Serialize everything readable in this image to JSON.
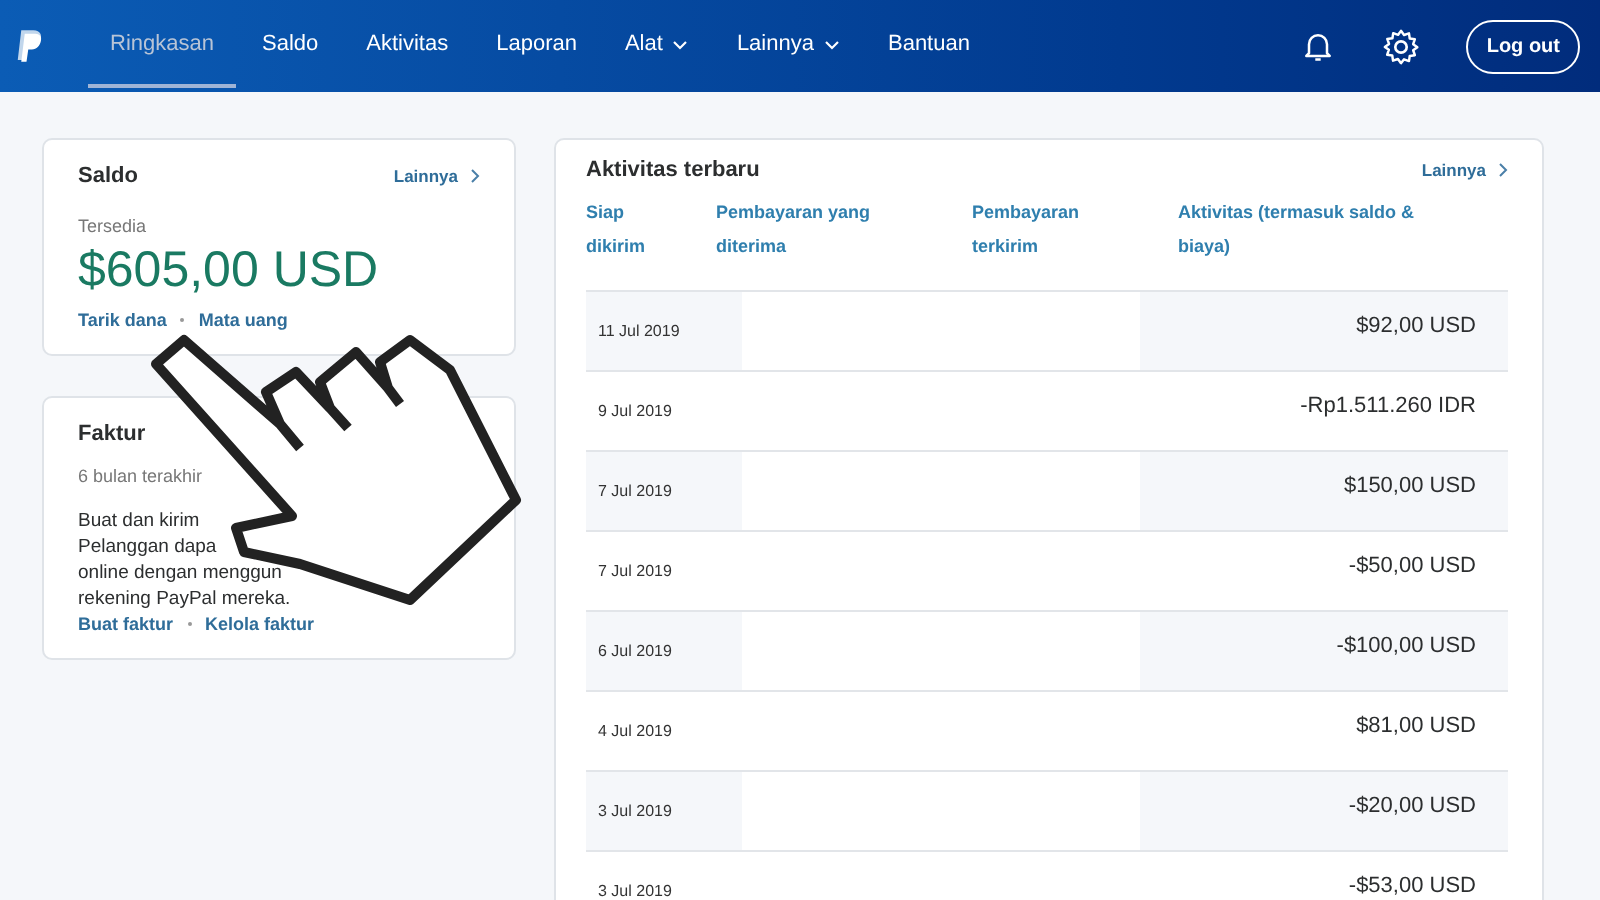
{
  "nav": {
    "items": [
      {
        "label": "Ringkasan",
        "selected": true,
        "has_menu": false
      },
      {
        "label": "Saldo",
        "selected": false,
        "has_menu": false
      },
      {
        "label": "Aktivitas",
        "selected": false,
        "has_menu": false
      },
      {
        "label": "Laporan",
        "selected": false,
        "has_menu": false
      },
      {
        "label": "Alat",
        "selected": false,
        "has_menu": true
      },
      {
        "label": "Lainnya",
        "selected": false,
        "has_menu": true
      },
      {
        "label": "Bantuan",
        "selected": false,
        "has_menu": false
      }
    ],
    "logout": "Log out"
  },
  "balance": {
    "title": "Saldo",
    "more": "Lainnya",
    "caption": "Tersedia",
    "amount": "$605,00 USD",
    "links": [
      "Tarik dana",
      "Mata uang"
    ]
  },
  "invoice": {
    "title": "Faktur",
    "caption": "6 bulan terakhir",
    "lines": [
      "Buat dan kirim",
      "Pelanggan dapa",
      "online dengan menggun",
      "rekening PayPal mereka."
    ],
    "links": [
      "Buat faktur",
      "Kelola faktur"
    ]
  },
  "activity": {
    "title": "Aktivitas terbaru",
    "more": "Lainnya",
    "columns": [
      "Siap dikirim",
      "Pembayaran yang diterima",
      "Pembayaran terkirim",
      "Aktivitas (termasuk saldo & biaya)"
    ],
    "rows": [
      {
        "date": "11 Jul 2019",
        "amount": "$92,00 USD"
      },
      {
        "date": "9 Jul 2019",
        "amount": "-Rp1.511.260 IDR"
      },
      {
        "date": "7 Jul 2019",
        "amount": "$150,00 USD"
      },
      {
        "date": "7 Jul 2019",
        "amount": "-$50,00 USD"
      },
      {
        "date": "6 Jul 2019",
        "amount": "-$100,00 USD"
      },
      {
        "date": "4 Jul 2019",
        "amount": "$81,00 USD"
      },
      {
        "date": "3 Jul 2019",
        "amount": "-$20,00 USD"
      },
      {
        "date": "3 Jul 2019",
        "amount": "-$53,00 USD"
      }
    ]
  }
}
